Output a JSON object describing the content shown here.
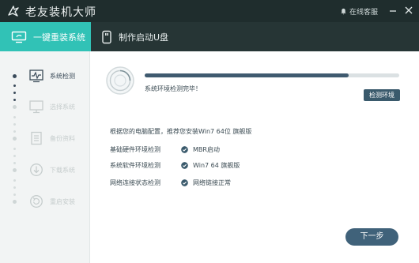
{
  "app": {
    "title": "老友装机大师"
  },
  "titlebar": {
    "support_label": "在线客服",
    "support_icon": "bell-icon"
  },
  "nav": {
    "tabs": [
      {
        "label": "一键重装系统",
        "icon": "monitor-icon",
        "active": true
      },
      {
        "label": "制作启动U盘",
        "icon": "usb-icon",
        "active": false
      }
    ]
  },
  "sidebar": {
    "steps": [
      {
        "label": "系统检测",
        "icon": "pulse-monitor-icon",
        "active": true
      },
      {
        "label": "选择系统",
        "icon": "monitor-icon",
        "active": false
      },
      {
        "label": "备份资料",
        "icon": "document-icon",
        "active": false
      },
      {
        "label": "下载系统",
        "icon": "download-icon",
        "active": false
      },
      {
        "label": "重启安装",
        "icon": "restart-icon",
        "active": false
      }
    ]
  },
  "main": {
    "progress_fraction": 0.8,
    "status_text": "系统环境检测完毕！",
    "detect_button": "检测环境",
    "summary": "根据您的电脑配置，推荐您安装Win7 64位 旗舰版",
    "checks": [
      {
        "label": "基础硬件环境检测",
        "value": "MBR启动"
      },
      {
        "label": "系统软件环境检测",
        "value": "Win7 64 旗舰版"
      },
      {
        "label": "网络连接状态检测",
        "value": "网络链接正常"
      }
    ],
    "next_button": "下一步"
  },
  "colors": {
    "accent": "#31c2b6",
    "titlebar": "#1f2d2d",
    "navbar": "#263535",
    "button": "#40627a",
    "ok": "#3a5a6c"
  }
}
